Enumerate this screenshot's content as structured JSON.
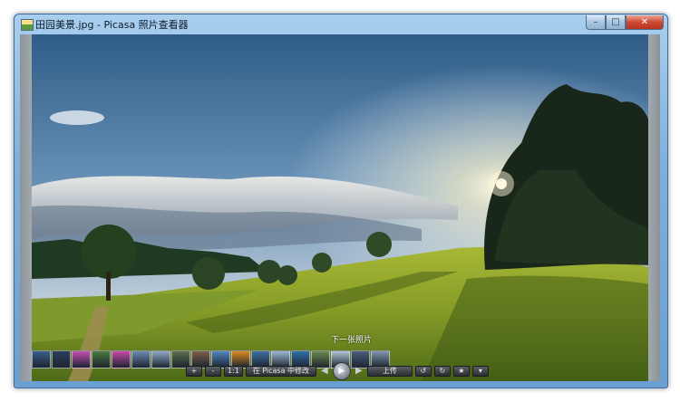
{
  "window": {
    "title": "田园美景.jpg - Picasa 照片查看器",
    "min_glyph": "–",
    "max_glyph": "□",
    "close_glyph": "✕"
  },
  "viewer": {
    "caption": "下一张照片",
    "thumb_colors": [
      "#3a5f8a",
      "#2b3f5f",
      "#c44fb0",
      "#4a7a3c",
      "#c84aa8",
      "#6a8ab0",
      "#8fa7c2",
      "#5a6f4a",
      "#7c5e4a",
      "#4f86bf",
      "#d8891f",
      "#3c6f9e",
      "#9cb7d2",
      "#2f6fa8",
      "#6c8a52",
      "#b2c6d8",
      "#4a5d7a",
      "#7f96ad"
    ]
  },
  "toolbar": {
    "zoom_in": "+",
    "zoom_out": "-",
    "actual_size": "1:1",
    "edit_in_picasa": "在 Picasa 中修改",
    "prev_glyph": "◀",
    "play_glyph": "▶",
    "next_glyph": "▶",
    "upload": "上传",
    "rotate_left": "↺",
    "rotate_right": "↻",
    "star": "★",
    "more": "▾"
  },
  "colors": {
    "titlebar": "#8dbbe5",
    "close": "#c8422b",
    "grass": "#8fa32a"
  }
}
